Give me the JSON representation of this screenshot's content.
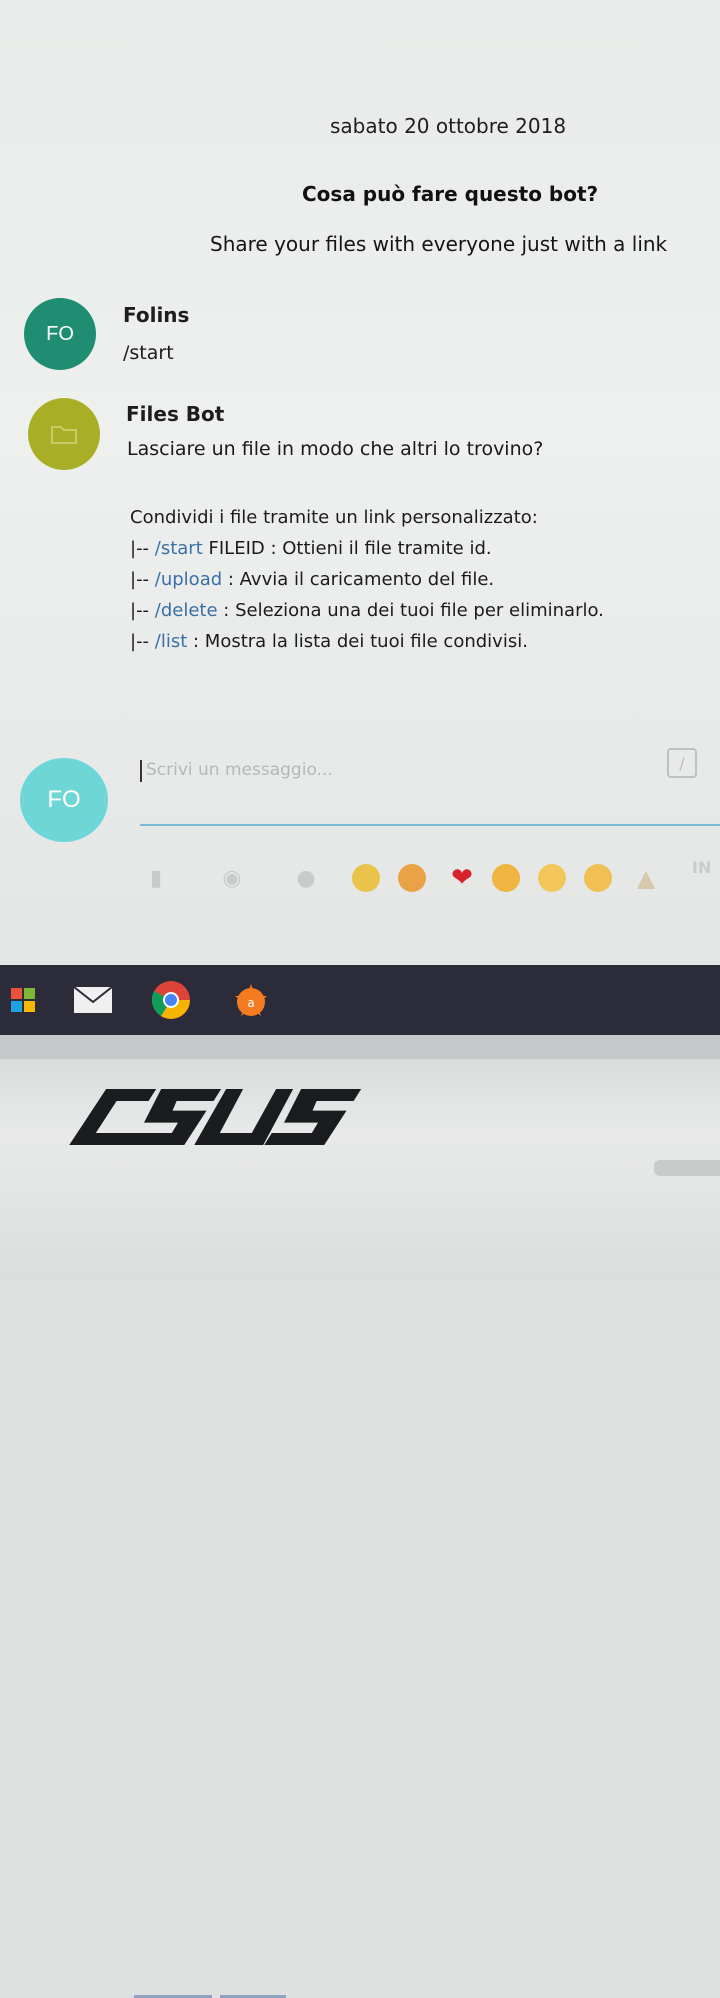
{
  "chat": {
    "date": "sabato 20 ottobre 2018",
    "bot_question": "Cosa può fare questo bot?",
    "bot_description": "Share your files with everyone just with a link"
  },
  "messages": [
    {
      "avatar_initials": "FO",
      "avatar_color": "#1e8d71",
      "sender": "Folins",
      "text": "/start"
    },
    {
      "avatar_color": "#a8ae25",
      "avatar_icon": "folder-icon",
      "sender": "Files Bot",
      "text": "Lasciare un file in modo che altri lo trovino?",
      "intro": "Condividi i file tramite un link personalizzato:",
      "commands": [
        {
          "prefix": "|-- ",
          "cmd": "/start",
          "desc": " FILEID : Ottieni il file tramite id."
        },
        {
          "prefix": "|-- ",
          "cmd": "/upload",
          "desc": " : Avvia il caricamento del file."
        },
        {
          "prefix": "|-- ",
          "cmd": "/delete",
          "desc": " : Seleziona una dei tuoi file per eliminarlo."
        },
        {
          "prefix": "|-- ",
          "cmd": "/list",
          "desc": " : Mostra la lista dei tuoi file condivisi."
        }
      ]
    }
  ],
  "composer": {
    "avatar_initials": "FO",
    "placeholder": "Scrivi un messaggio...",
    "send_label": "IN"
  },
  "toolbar_icons": [
    "file-icon",
    "camera-icon",
    "microphone-icon",
    "emoji-laugh-icon",
    "emoji-kiss-icon",
    "heart-icon",
    "emoji-heart-eyes-icon",
    "emoji-smile-icon",
    "emoji-grin-icon",
    "thumbs-up-icon"
  ],
  "taskbar_icons": [
    "start-icon",
    "mail-icon",
    "chrome-icon",
    "avast-icon"
  ],
  "laptop": {
    "brand": "ASUS"
  },
  "colors": {
    "link": "#3b6fa6",
    "taskbar": "#2c2b3a",
    "input_underline": "#7fb8d3"
  }
}
